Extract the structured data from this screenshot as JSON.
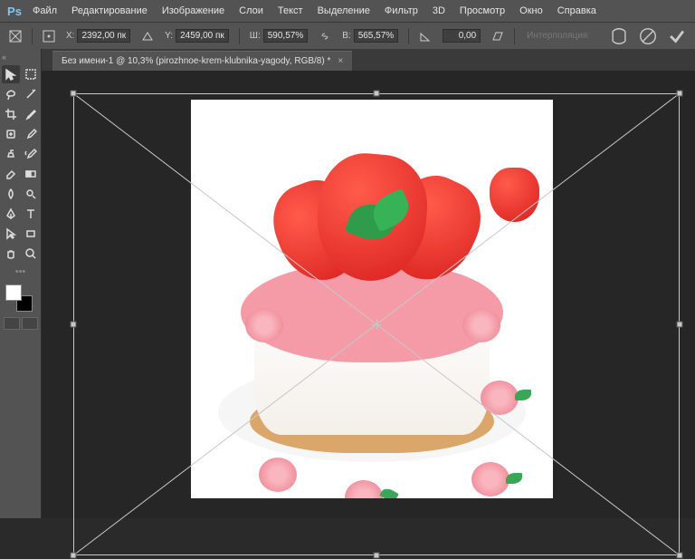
{
  "app": {
    "logo": "Ps"
  },
  "menu": [
    "Файл",
    "Редактирование",
    "Изображение",
    "Слои",
    "Текст",
    "Выделение",
    "Фильтр",
    "3D",
    "Просмотр",
    "Окно",
    "Справка"
  ],
  "options": {
    "x_label": "X:",
    "x_value": "2392,00 пк",
    "y_label": "Y:",
    "y_value": "2459,00 пк",
    "w_label": "Ш:",
    "w_value": "590,57%",
    "h_label": "В:",
    "h_value": "565,57%",
    "angle_label": "",
    "angle_value": "0,00",
    "interp": "Интерполяция:"
  },
  "tab": {
    "title": "Без имени-1 @ 10,3% (pirozhnoe-krem-klubnika-yagody, RGB/8) *"
  },
  "tools": [
    "move",
    "marquee",
    "lasso",
    "magic-wand",
    "crop",
    "slice",
    "eyedropper",
    "brush",
    "healing",
    "clone",
    "history-brush",
    "eraser",
    "gradient",
    "blur",
    "dodge",
    "pen",
    "type",
    "path-select",
    "rectangle",
    "hand",
    "zoom",
    "edit-toolbar"
  ],
  "colors": {
    "foreground": "#ffffff",
    "background": "#000000"
  }
}
